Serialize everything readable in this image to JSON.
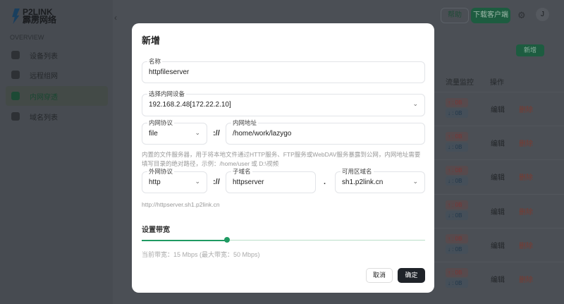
{
  "sidebar": {
    "logo_top": "P2LINK",
    "logo_bottom": "霹雳网络",
    "section": "OVERVIEW",
    "items": [
      {
        "label": "设备列表"
      },
      {
        "label": "远程组网"
      },
      {
        "label": "内网穿透"
      },
      {
        "label": "域名列表"
      }
    ]
  },
  "header": {
    "help": "帮助",
    "download": "下载客户端",
    "avatar": "J"
  },
  "page": {
    "new_button": "新增",
    "columns": [
      "流量监控",
      "操作"
    ],
    "row": {
      "up": "↑ : 0B",
      "down": "↓ : 0B",
      "edit": "编辑",
      "delete": "删除"
    }
  },
  "modal": {
    "title": "新增",
    "name": {
      "label": "名称",
      "value": "httpfileserver"
    },
    "device": {
      "label": "选择内网设备",
      "value": "192.168.2.48[172.22.2.10]"
    },
    "inner_protocol": {
      "label": "内网协议",
      "value": "file"
    },
    "sep1": "://",
    "inner_address": {
      "label": "内网地址",
      "value": "/home/work/lazygo"
    },
    "hint": "内置的文件服务器，用于将本地文件通过HTTP服务、FTP服务或WebDAV服务暴露到公网，内网地址需要填写目录的绝对路径，示例：/home/user 或 D:\\视频",
    "outer_protocol": {
      "label": "外网协议",
      "value": "http"
    },
    "sep2": "://",
    "subdomain": {
      "label": "子域名",
      "value": "httpserver"
    },
    "dot": ".",
    "domain": {
      "label": "可用区域名",
      "value": "sh1.p2link.cn"
    },
    "url_preview": "http://httpserver.sh1.p2link.cn",
    "bandwidth_label": "设置带宽",
    "bandwidth_current": 15,
    "bandwidth_max": 50,
    "bandwidth_text": "当前带宽：15 Mbps (最大带宽：50 Mbps)",
    "cancel": "取消",
    "ok": "确定"
  }
}
